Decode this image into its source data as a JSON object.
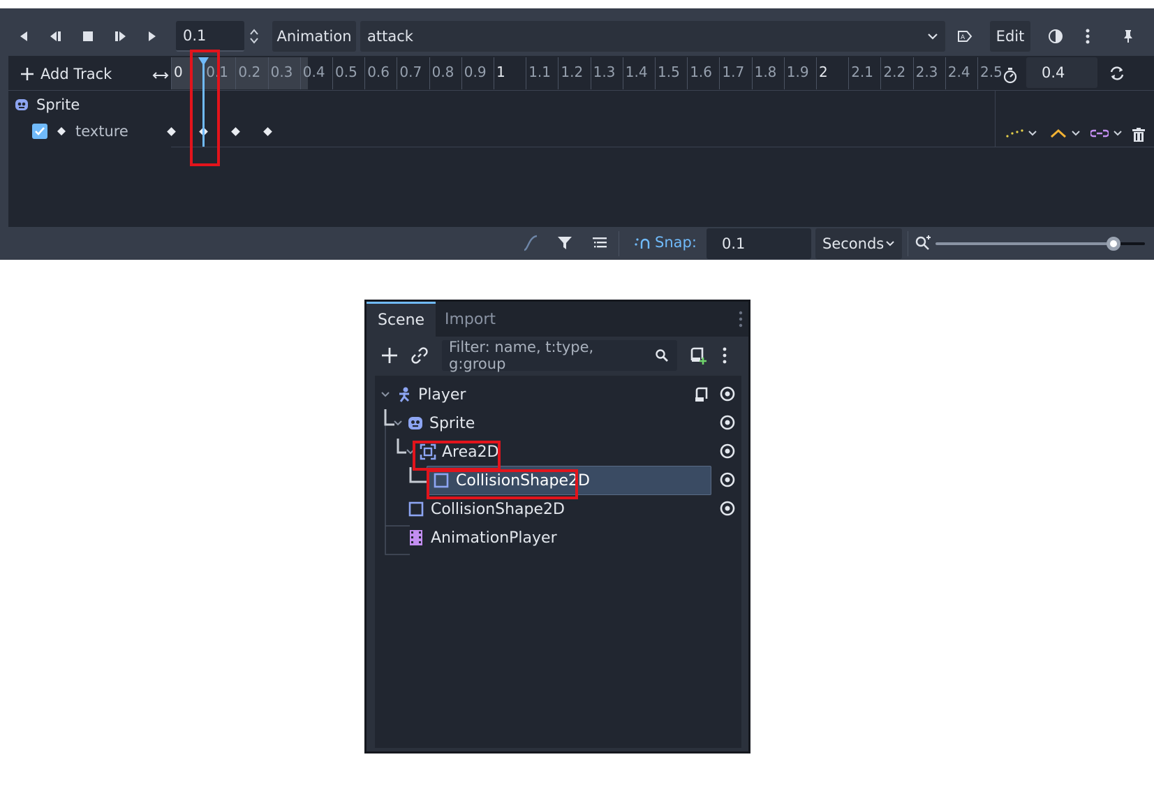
{
  "animation_panel": {
    "step_value": "0.1",
    "animation_label": "Animation",
    "animation_name": "attack",
    "edit_label": "Edit",
    "add_track_label": "Add Track",
    "length_value": "0.4",
    "ruler_ticks": [
      "0",
      "0.1",
      "0.2",
      "0.3",
      "0.4",
      "0.5",
      "0.6",
      "0.7",
      "0.8",
      "0.9",
      "1",
      "1.1",
      "1.2",
      "1.3",
      "1.4",
      "1.5",
      "1.6",
      "1.7",
      "1.8",
      "1.9",
      "2",
      "2.1",
      "2.2",
      "2.3",
      "2.4",
      "2.5"
    ],
    "playhead_time": 0.1,
    "tracks": {
      "node_name": "Sprite",
      "property_name": "texture",
      "property_enabled": true,
      "keyframe_times": [
        0,
        0.1,
        0.2,
        0.3
      ]
    },
    "snap_label": "Snap:",
    "snap_value": "0.1",
    "snap_unit": "Seconds",
    "zoom_level": 0.85
  },
  "scene_dock": {
    "tabs": [
      "Scene",
      "Import"
    ],
    "active_tab": "Scene",
    "filter_placeholder": "Filter: name, t:type, g:group",
    "nodes": [
      {
        "name": "Player",
        "type": "CharacterBody2D"
      },
      {
        "name": "Sprite",
        "type": "Sprite2D"
      },
      {
        "name": "Area2D",
        "type": "Area2D"
      },
      {
        "name": "CollisionShape2D",
        "type": "CollisionShape2D",
        "selected": true
      },
      {
        "name": "CollisionShape2D",
        "type": "CollisionShape2D"
      },
      {
        "name": "AnimationPlayer",
        "type": "AnimationPlayer"
      }
    ]
  },
  "colors": {
    "accent": "#70bafa",
    "highlight_box": "#e2141c",
    "selected_row": "#3a4b63",
    "node_icon": "#8da5f3",
    "animation_icon": "#c38ef1"
  }
}
